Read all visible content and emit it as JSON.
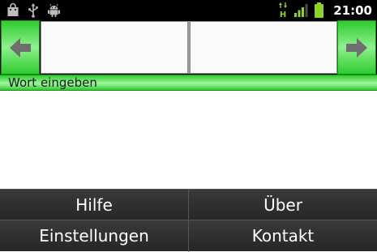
{
  "status_bar": {
    "time": "21:00",
    "icons_left": [
      "shopping-bag-icon",
      "usb-icon",
      "android-icon"
    ],
    "icons_right": [
      "hspa-data-icon",
      "signal-icon",
      "battery-icon"
    ]
  },
  "translator": {
    "back_button_icon": "arrow-left-icon",
    "forward_button_icon": "arrow-right-icon",
    "left_field_value": "",
    "right_field_value": "",
    "hint": "Wort eingeben"
  },
  "menu": {
    "items": [
      {
        "label": "Hilfe"
      },
      {
        "label": "Über"
      },
      {
        "label": "Einstellungen"
      },
      {
        "label": "Kontakt"
      }
    ]
  },
  "colors": {
    "accent_green": "#2fcc2f",
    "status_bar": "#000000",
    "menu_background": "#262626"
  }
}
